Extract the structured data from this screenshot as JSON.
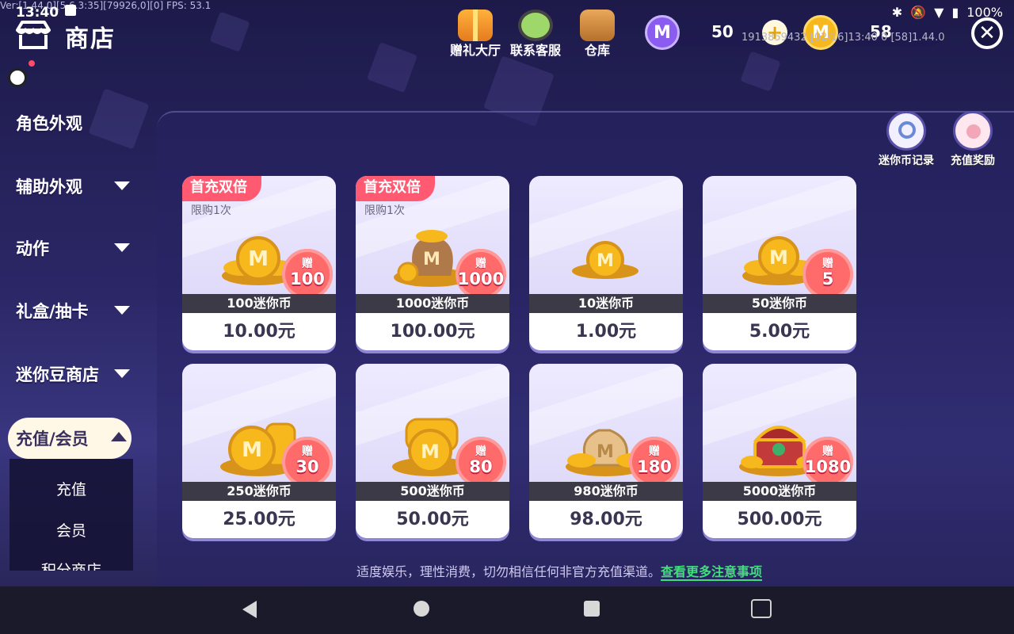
{
  "status_bar": {
    "debug": "Ver:[1.44.0][5.6.3:35][79926,0][0] FPS: 53.1",
    "time": "13:40",
    "battery": "100%"
  },
  "header": {
    "title": "商店",
    "buttons": [
      {
        "label": "赠礼大厅",
        "icon": "gift-hall-icon"
      },
      {
        "label": "联系客服",
        "icon": "customer-service-icon"
      },
      {
        "label": "仓库",
        "icon": "warehouse-icon"
      }
    ],
    "mini_beans": "50",
    "mini_coins": "58"
  },
  "sidebar": {
    "items": [
      {
        "label": "角色外观"
      },
      {
        "label": "辅助外观"
      },
      {
        "label": "动作"
      },
      {
        "label": "礼盒/抽卡"
      },
      {
        "label": "迷你豆商店"
      }
    ],
    "active": "充值/会员",
    "sub_items": [
      "充值",
      "会员",
      "积分商店"
    ]
  },
  "records": [
    {
      "label": "迷你币记录",
      "icon": "coin-record-icon"
    },
    {
      "label": "充值奖励",
      "icon": "recharge-reward-icon"
    }
  ],
  "products": [
    {
      "name": "100迷你币",
      "price": "10.00元",
      "tag": "首充双倍",
      "limit": "限购1次",
      "bonus_label": "赠",
      "bonus": "100"
    },
    {
      "name": "1000迷你币",
      "price": "100.00元",
      "tag": "首充双倍",
      "limit": "限购1次",
      "bonus_label": "赠",
      "bonus": "1000"
    },
    {
      "name": "10迷你币",
      "price": "1.00元",
      "tag": "",
      "limit": "",
      "bonus_label": "",
      "bonus": ""
    },
    {
      "name": "50迷你币",
      "price": "5.00元",
      "tag": "",
      "limit": "",
      "bonus_label": "赠",
      "bonus": "5"
    },
    {
      "name": "250迷你币",
      "price": "25.00元",
      "tag": "",
      "limit": "",
      "bonus_label": "赠",
      "bonus": "30"
    },
    {
      "name": "500迷你币",
      "price": "50.00元",
      "tag": "",
      "limit": "",
      "bonus_label": "赠",
      "bonus": "80"
    },
    {
      "name": "980迷你币",
      "price": "98.00元",
      "tag": "",
      "limit": "",
      "bonus_label": "赠",
      "bonus": "180"
    },
    {
      "name": "5000迷你币",
      "price": "500.00元",
      "tag": "",
      "limit": "",
      "bonus_label": "赠",
      "bonus": "1080"
    }
  ],
  "notice": {
    "text": "适度娱乐，理性消费，切勿相信任何非官方充值渠道。",
    "link": "查看更多注意事项"
  },
  "footer": {
    "info": "1913859432    [02/16]13:40 0   [58]1.44.0"
  },
  "colors": {
    "tag": "#ff5a72",
    "bonus": "#ff6b6b",
    "link": "#3fe07a",
    "coin": "#f6b81c"
  }
}
